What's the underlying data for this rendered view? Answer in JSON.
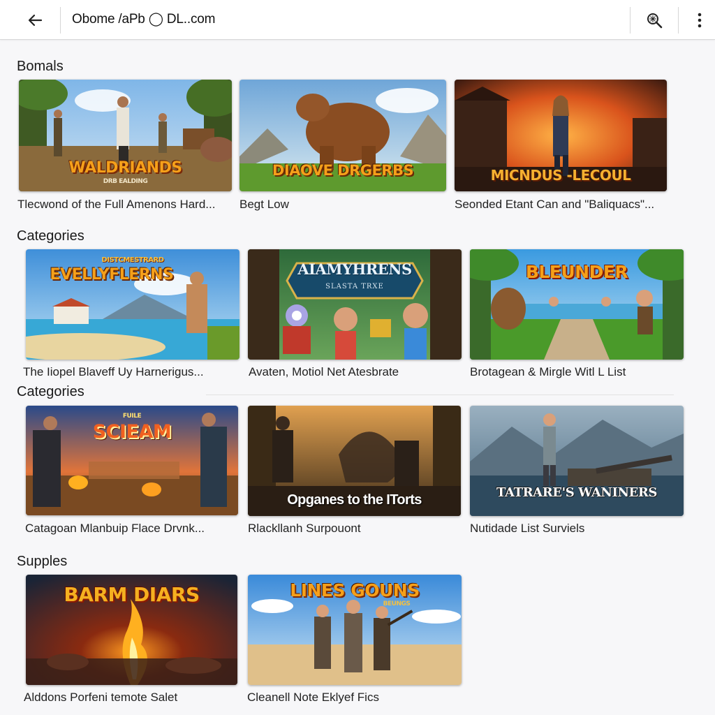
{
  "header": {
    "address": "Obome /aPb ◯ DL..com",
    "icons": {
      "back": "back-arrow-icon",
      "search": "search-icon",
      "more": "more-vert-icon"
    }
  },
  "sections": [
    {
      "title": "Bomals"
    },
    {
      "title": "Categories"
    },
    {
      "title": "Categories"
    },
    {
      "title": "Supples"
    }
  ],
  "cards": [
    {
      "logo": "WALDRIANDS",
      "logo_sub": "DRB EALDING",
      "caption": "Tlecwond of the Full Amenons Hard..."
    },
    {
      "logo": "DIAOVE DRGERBS",
      "logo_sub": "",
      "caption": "Begt Low"
    },
    {
      "logo": "MICNDUS -LECOUL",
      "logo_sub": "",
      "caption": "Seonded Etant Can and \"Baliquacs\"..."
    },
    {
      "logo": "EVELLYFLERNS",
      "logo_sub": "DISTCMESTRARD",
      "caption": "The Iiopel Blaveff Uy Harnerigus..."
    },
    {
      "logo": "AIAMYHRENS",
      "logo_sub": "SLASTA TRXE",
      "caption": "Avaten, Motiol Net Atesbrate"
    },
    {
      "logo": "BLEUNDER",
      "logo_sub": "",
      "caption": "Brotagean & Mirgle Witl L List"
    },
    {
      "logo": "SCIEAM",
      "logo_sub": "FUILE",
      "caption": "Catagoan Mlanbuip Flace Drvnk..."
    },
    {
      "logo": "Opganes to the ITorts",
      "logo_sub": "",
      "caption": "Rlackllanh Surpouont"
    },
    {
      "logo": "TATRARE'S WANINERS",
      "logo_sub": "",
      "caption": "Nutidade List Surviels"
    },
    {
      "logo": "BARM DIARS",
      "logo_sub": "",
      "caption": "Alddons Porfeni temote Salet"
    },
    {
      "logo": "LINES GOUNS",
      "logo_sub": "BEUNGS",
      "caption": "Cleanell Note Eklyef Fics"
    }
  ],
  "colors": {
    "header_bg": "#ffffff",
    "page_bg": "#f7f7f9",
    "logo_orange": "#f5a01a",
    "logo_red": "#e8401c"
  }
}
